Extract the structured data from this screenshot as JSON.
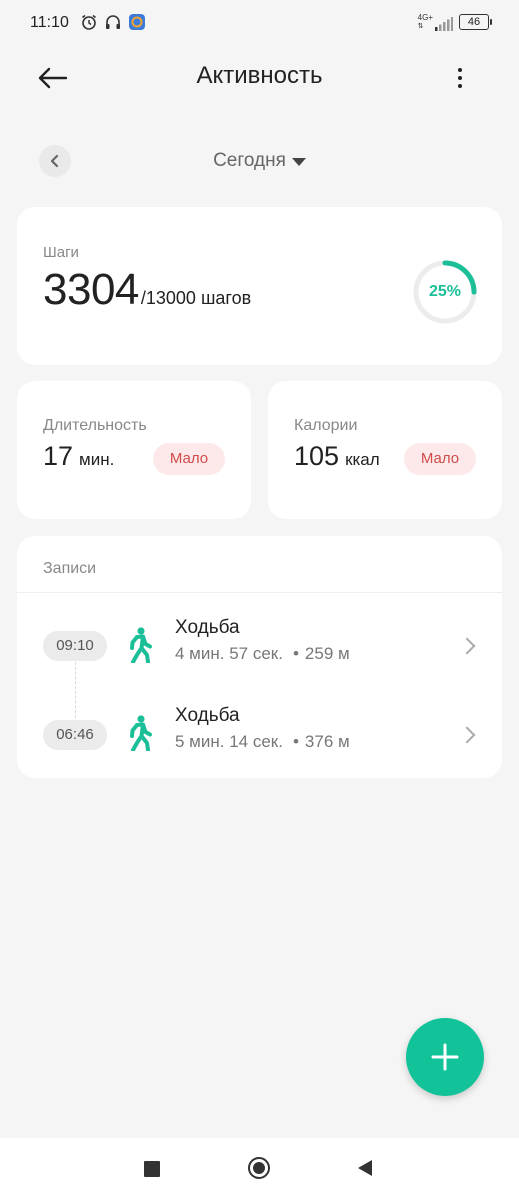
{
  "status_bar": {
    "time": "11:10",
    "network": "4G+",
    "battery": "46",
    "icons": [
      "alarm-icon",
      "headphones-icon",
      "app-notification-icon",
      "signal-icon",
      "battery-icon"
    ]
  },
  "header": {
    "title": "Активность",
    "back_icon": "arrow-left-icon",
    "more_icon": "more-vertical-icon"
  },
  "date_selector": {
    "label": "Сегодня",
    "prev_icon": "chevron-left-icon",
    "dropdown_icon": "triangle-down-icon"
  },
  "steps": {
    "label": "Шаги",
    "value": "3304",
    "goal": "/13000 шагов",
    "percent_text": "25%",
    "progress": 0.25
  },
  "duration": {
    "label": "Длительность",
    "value": "17",
    "unit": "мин.",
    "badge": "Мало"
  },
  "calories": {
    "label": "Калории",
    "value": "105",
    "unit": "ккал",
    "badge": "Мало"
  },
  "records": {
    "title": "Записи",
    "items": [
      {
        "time": "09:10",
        "activity": "Ходьба",
        "duration": "4 мин. 57 сек.",
        "distance": "259 м",
        "icon": "walking-icon"
      },
      {
        "time": "06:46",
        "activity": "Ходьба",
        "duration": "5 мин. 14 сек.",
        "distance": "376 м",
        "icon": "walking-icon"
      }
    ]
  },
  "colors": {
    "accent": "#12c39a",
    "background": "#f5f5f5",
    "badge_bg": "#fde9e9",
    "badge_text": "#d24a4a"
  },
  "fab": {
    "icon": "plus-icon"
  },
  "nav_bar": {
    "icons": [
      "recent-apps-icon",
      "home-icon",
      "back-icon"
    ]
  }
}
